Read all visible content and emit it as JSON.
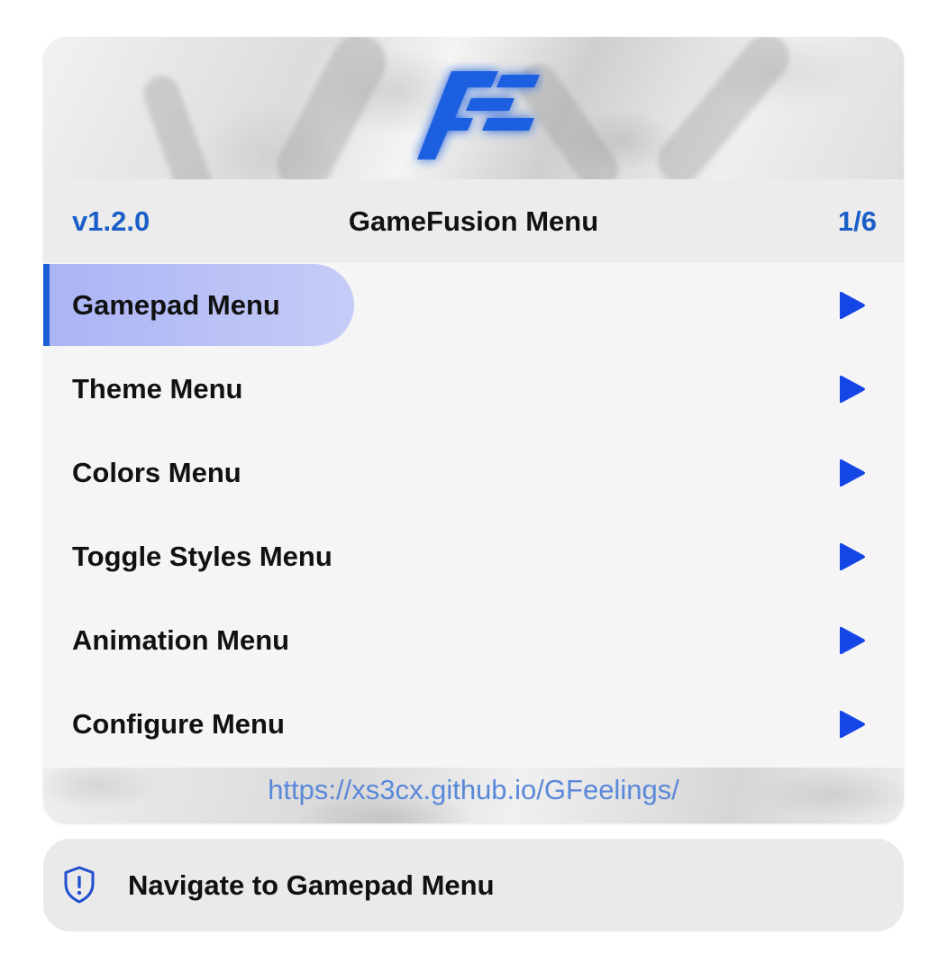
{
  "header": {
    "version": "v1.2.0",
    "title": "GameFusion Menu",
    "page_indicator": "1/6"
  },
  "logo": {
    "icon": "gamefusion-logo",
    "color": "#1f5fe0"
  },
  "menu": {
    "selected_index": 0,
    "items": [
      {
        "label": "Gamepad Menu",
        "icon": "play-arrow-icon"
      },
      {
        "label": "Theme Menu",
        "icon": "play-arrow-icon"
      },
      {
        "label": "Colors Menu",
        "icon": "play-arrow-icon"
      },
      {
        "label": "Toggle Styles Menu",
        "icon": "play-arrow-icon"
      },
      {
        "label": "Animation Menu",
        "icon": "play-arrow-icon"
      },
      {
        "label": "Configure Menu",
        "icon": "play-arrow-icon"
      }
    ]
  },
  "footer": {
    "link": "https://xs3cx.github.io/GFeelings/"
  },
  "status": {
    "icon": "shield-exclamation-icon",
    "text": "Navigate to Gamepad Menu"
  },
  "colors": {
    "accent": "#1f5fd6",
    "version_text": "#1a5fc8",
    "arrow": "#1446e6",
    "highlight": "#b4bdf6",
    "link": "#5a88d8"
  }
}
